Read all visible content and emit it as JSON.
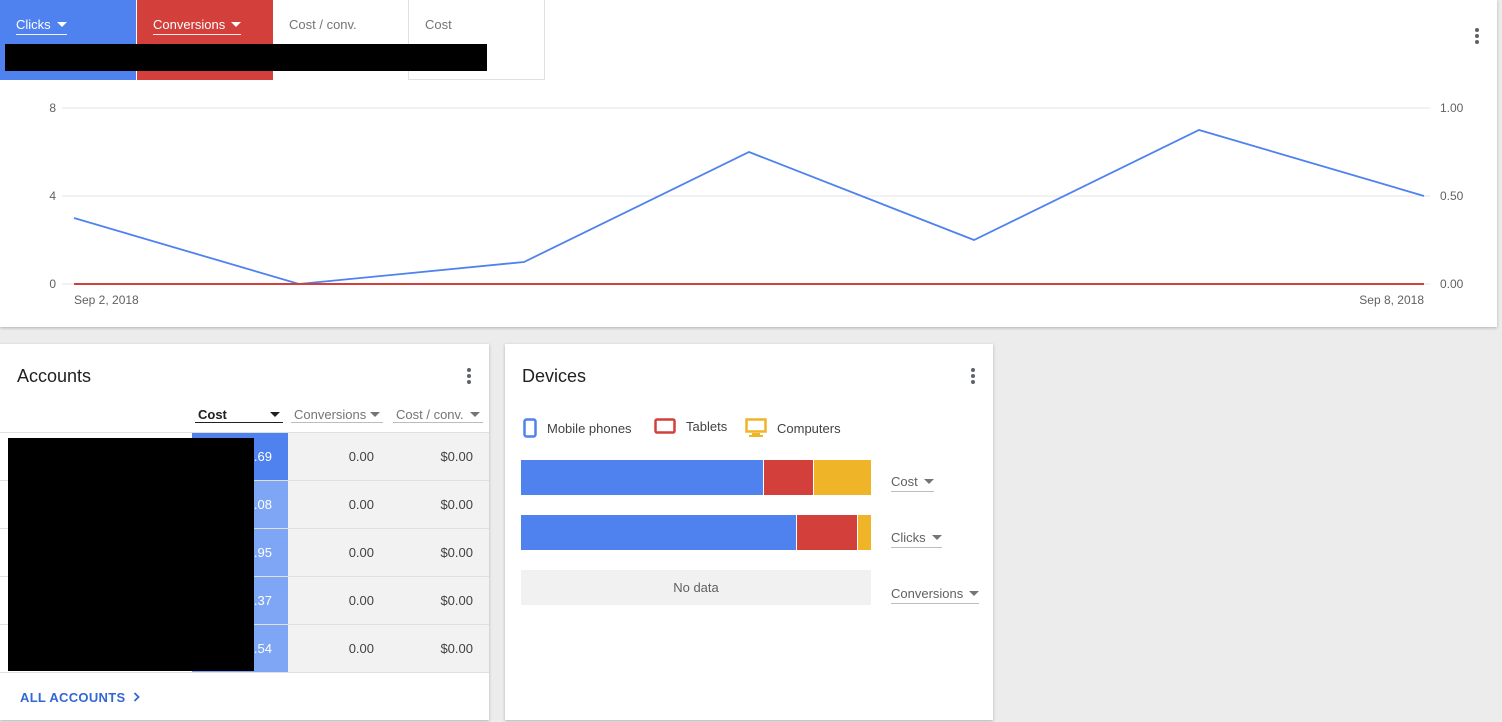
{
  "performance": {
    "metrics": [
      {
        "label": "Clicks",
        "color": "#4f82ee",
        "selected": true
      },
      {
        "label": "Conversions",
        "color": "#d33f3a",
        "selected": true
      },
      {
        "label": "Cost / conv.",
        "selected": false
      },
      {
        "label": "Cost",
        "selected": false
      }
    ],
    "menu_icon": "more-vert-icon"
  },
  "chart_data": {
    "type": "line",
    "x": [
      "Sep 2, 2018",
      "Sep 3, 2018",
      "Sep 4, 2018",
      "Sep 5, 2018",
      "Sep 6, 2018",
      "Sep 7, 2018",
      "Sep 8, 2018"
    ],
    "x_tick_labels": [
      "Sep 2, 2018",
      "Sep 8, 2018"
    ],
    "series": [
      {
        "name": "Clicks",
        "color": "#4f82ee",
        "axis": "left",
        "values": [
          3,
          0,
          1,
          6,
          2,
          7,
          4
        ]
      },
      {
        "name": "Conversions",
        "color": "#d33f3a",
        "axis": "right",
        "values": [
          0,
          0,
          0,
          0,
          0,
          0,
          0
        ]
      }
    ],
    "y_left": {
      "ticks": [
        "0",
        "4",
        "8"
      ],
      "range": [
        0,
        8
      ]
    },
    "y_right": {
      "ticks": [
        "0.00",
        "0.50",
        "1.00"
      ],
      "range": [
        0,
        1
      ]
    },
    "grid": true,
    "title": "",
    "xlabel": "",
    "ylabel": ""
  },
  "accounts": {
    "title": "Accounts",
    "columns": [
      {
        "label": "Cost",
        "sorted": true
      },
      {
        "label": "Conversions",
        "sorted": false
      },
      {
        "label": "Cost / conv.",
        "sorted": false
      }
    ],
    "rows": [
      {
        "cost": ".69",
        "conversions": "0.00",
        "cost_per_conv": "$0.00"
      },
      {
        "cost": ".08",
        "conversions": "0.00",
        "cost_per_conv": "$0.00"
      },
      {
        "cost": ".95",
        "conversions": "0.00",
        "cost_per_conv": "$0.00"
      },
      {
        "cost": ".37",
        "conversions": "0.00",
        "cost_per_conv": "$0.00"
      },
      {
        "cost": ".54",
        "conversions": "0.00",
        "cost_per_conv": "$0.00"
      }
    ],
    "footer_link": "ALL ACCOUNTS",
    "footer_icon": "chevron-right-icon"
  },
  "devices": {
    "title": "Devices",
    "legend": [
      {
        "label": "Mobile phones",
        "icon": "mobile-phone-icon",
        "color": "#4f82ee"
      },
      {
        "label": "Tablets",
        "icon": "tablet-icon",
        "color": "#d33f3a"
      },
      {
        "label": "Computers",
        "icon": "computer-icon",
        "color": "#f0b429"
      }
    ],
    "metrics": [
      {
        "label": "Cost",
        "shares": [
          0.69,
          0.145,
          0.165
        ]
      },
      {
        "label": "Clicks",
        "shares": [
          0.785,
          0.175,
          0.04
        ]
      },
      {
        "label": "Conversions",
        "shares": null,
        "empty_text": "No data"
      }
    ]
  }
}
